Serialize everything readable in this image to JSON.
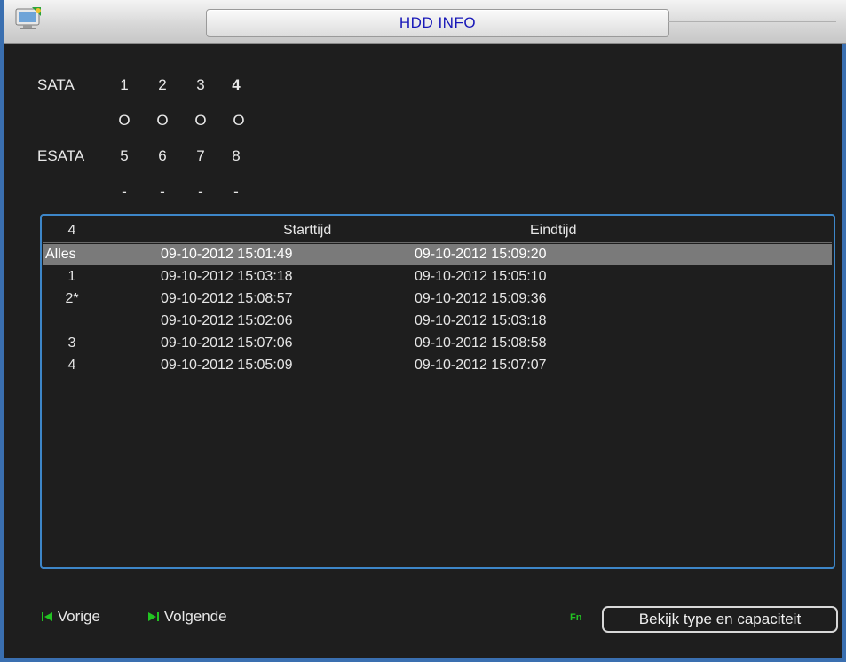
{
  "window": {
    "title": "HDD INFO"
  },
  "sata": {
    "label": "SATA",
    "ports": [
      "1",
      "2",
      "3",
      "4"
    ],
    "status": [
      "O",
      "O",
      "O",
      "O"
    ]
  },
  "esata": {
    "label": "ESATA",
    "ports": [
      "5",
      "6",
      "7",
      "8"
    ],
    "status": [
      "-",
      "-",
      "-",
      "-"
    ]
  },
  "table": {
    "header": {
      "index": "4",
      "start": "Starttijd",
      "end": "Eindtijd"
    },
    "rows": [
      {
        "index": "Alles",
        "start": "09-10-2012 15:01:49",
        "end": "09-10-2012 15:09:20",
        "selected": true
      },
      {
        "index": "1",
        "start": "09-10-2012 15:03:18",
        "end": "09-10-2012 15:05:10"
      },
      {
        "index": "2*",
        "start": "09-10-2012 15:08:57",
        "end": "09-10-2012 15:09:36"
      },
      {
        "index": "",
        "start": "09-10-2012 15:02:06",
        "end": "09-10-2012 15:03:18"
      },
      {
        "index": "3",
        "start": "09-10-2012 15:07:06",
        "end": "09-10-2012 15:08:58"
      },
      {
        "index": "4",
        "start": "09-10-2012 15:05:09",
        "end": "09-10-2012 15:07:07"
      }
    ]
  },
  "footer": {
    "prev_label": "Vorige",
    "next_label": "Volgende",
    "fn_label": "Fn",
    "capacity_button": "Bekijk type en capaciteit"
  },
  "colors": {
    "accent_green": "#22c322",
    "title_text": "#1818b8",
    "list_border": "#3d86c8"
  }
}
